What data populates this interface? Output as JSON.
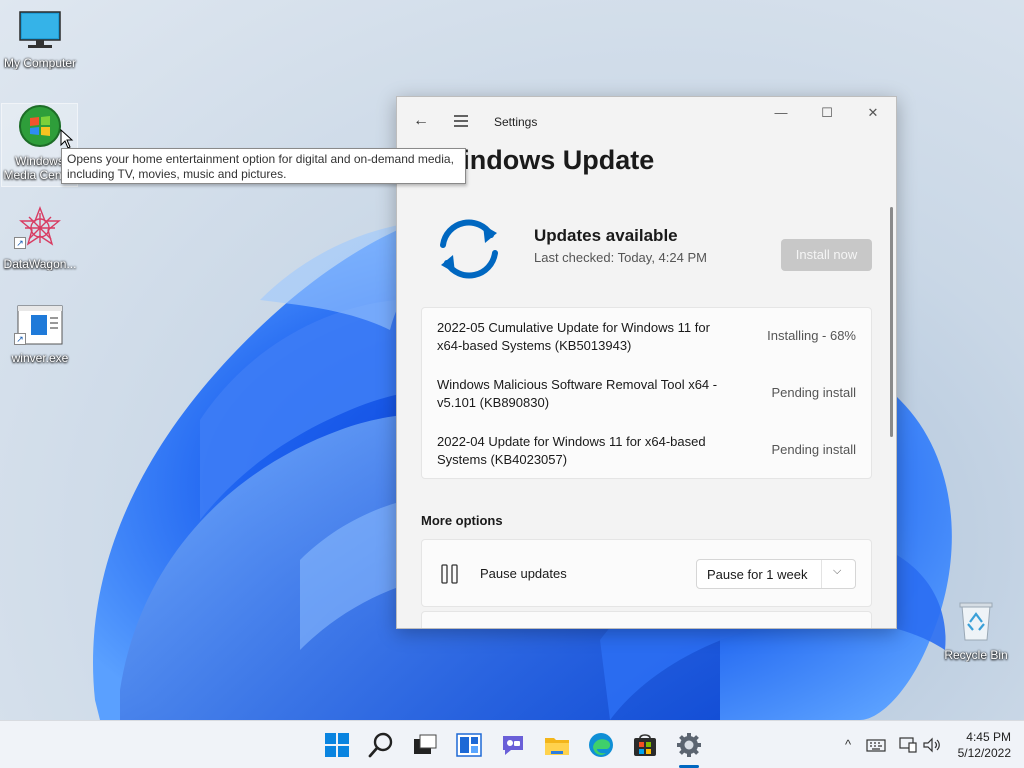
{
  "desktop": {
    "icons": [
      {
        "label": "My Computer"
      },
      {
        "label": "Windows Media Center"
      },
      {
        "label": "DataWagon..."
      },
      {
        "label": "winver.exe"
      },
      {
        "label": "Recycle Bin"
      }
    ],
    "tooltip": "Opens your home entertainment option for digital and on-demand media, including TV, movies, music and pictures."
  },
  "window": {
    "app_title": "Settings",
    "page_title": "Windows Update",
    "status": {
      "heading": "Updates available",
      "last_checked": "Last checked: Today, 4:24 PM",
      "install_button": "Install now"
    },
    "updates": [
      {
        "name": "2022-05 Cumulative Update for Windows 11 for x64-based Systems (KB5013943)",
        "status": "Installing - 68%",
        "progress_percent": 68
      },
      {
        "name": "Windows Malicious Software Removal Tool x64 - v5.101 (KB890830)",
        "status": "Pending install"
      },
      {
        "name": "2022-04 Update for Windows 11 for x64-based Systems (KB4023057)",
        "status": "Pending install"
      }
    ],
    "more_options": {
      "heading": "More options",
      "pause": {
        "label": "Pause updates",
        "selected": "Pause for 1 week"
      }
    }
  },
  "taskbar": {
    "apps": [
      "start-icon",
      "search-icon",
      "task-view-icon",
      "widgets-icon",
      "chat-icon",
      "file-explorer-icon",
      "edge-icon",
      "store-icon",
      "settings-icon"
    ],
    "clock": {
      "time": "4:45 PM",
      "date": "5/12/2022"
    }
  },
  "colors": {
    "accent": "#0067c0",
    "install_disabled": "#c8c8c8"
  }
}
